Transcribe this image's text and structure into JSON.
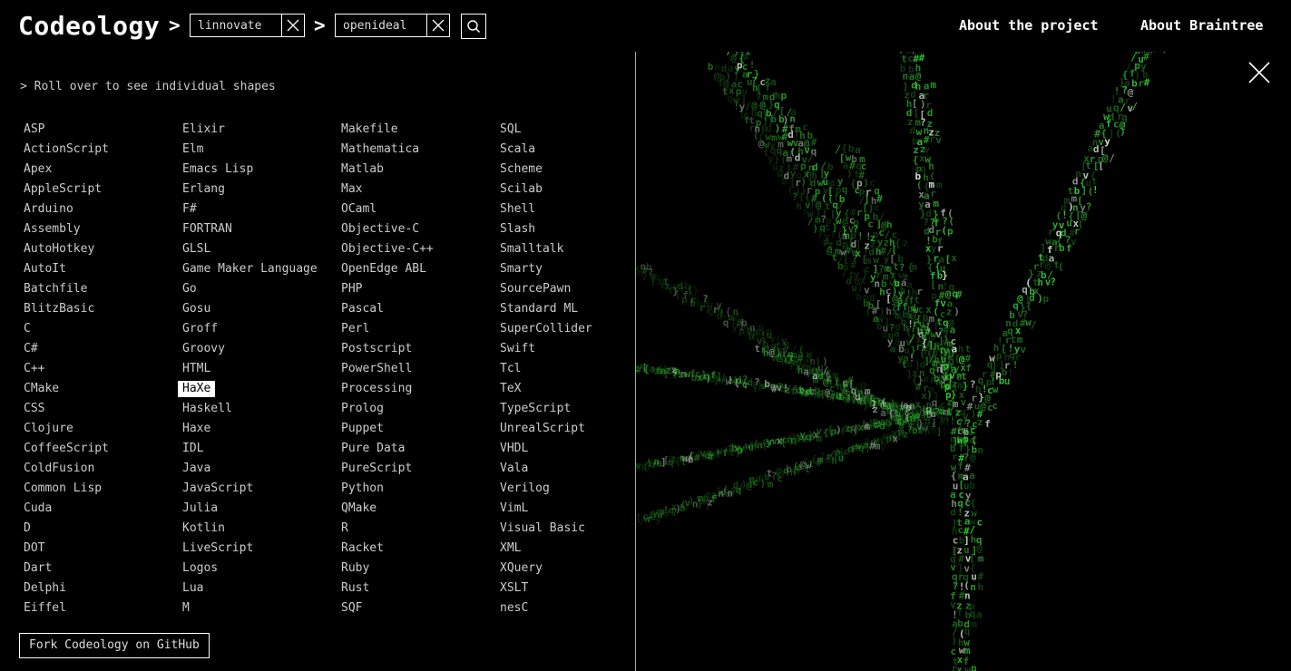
{
  "header": {
    "logo": "Codeology",
    "sep": ">",
    "crumb1": "linnovate",
    "crumb2": "openideal",
    "nav": [
      "About the project",
      "About Braintree"
    ]
  },
  "hint": "> Roll over to see individual shapes",
  "languages": [
    [
      "ASP",
      "ActionScript",
      "Apex",
      "AppleScript",
      "Arduino",
      "Assembly",
      "AutoHotkey",
      "AutoIt",
      "Batchfile",
      "BlitzBasic",
      "C",
      "C#",
      "C++",
      "CMake",
      "CSS",
      "Clojure",
      "CoffeeScript",
      "ColdFusion",
      "Common Lisp",
      "Cuda",
      "D",
      "DOT",
      "Dart",
      "Delphi",
      "Eiffel"
    ],
    [
      "Elixir",
      "Elm",
      "Emacs Lisp",
      "Erlang",
      "F#",
      "FORTRAN",
      "GLSL",
      "Game Maker Language",
      "Go",
      "Gosu",
      "Groff",
      "Groovy",
      "HTML",
      "HaXe",
      "Haskell",
      "Haxe",
      "IDL",
      "Java",
      "JavaScript",
      "Julia",
      "Kotlin",
      "LiveScript",
      "Logos",
      "Lua",
      "M"
    ],
    [
      "Makefile",
      "Mathematica",
      "Matlab",
      "Max",
      "OCaml",
      "Objective-C",
      "Objective-C++",
      "OpenEdge ABL",
      "PHP",
      "Pascal",
      "Perl",
      "Postscript",
      "PowerShell",
      "Processing",
      "Prolog",
      "Puppet",
      "Pure Data",
      "PureScript",
      "Python",
      "QMake",
      "R",
      "Racket",
      "Ruby",
      "Rust",
      "SQF"
    ],
    [
      "SQL",
      "Scala",
      "Scheme",
      "Scilab",
      "Shell",
      "Slash",
      "Smalltalk",
      "Smarty",
      "SourcePawn",
      "Standard ML",
      "SuperCollider",
      "Swift",
      "Tcl",
      "TeX",
      "TypeScript",
      "UnrealScript",
      "VHDL",
      "Vala",
      "Verilog",
      "VimL",
      "Visual Basic",
      "XML",
      "XQuery",
      "XSLT",
      "nesC"
    ]
  ],
  "active_language": "HaXe",
  "fork_label": "Fork Codeology on GitHub",
  "colors": {
    "accent": "#3cd93c",
    "dim": "#1f6e1f"
  }
}
